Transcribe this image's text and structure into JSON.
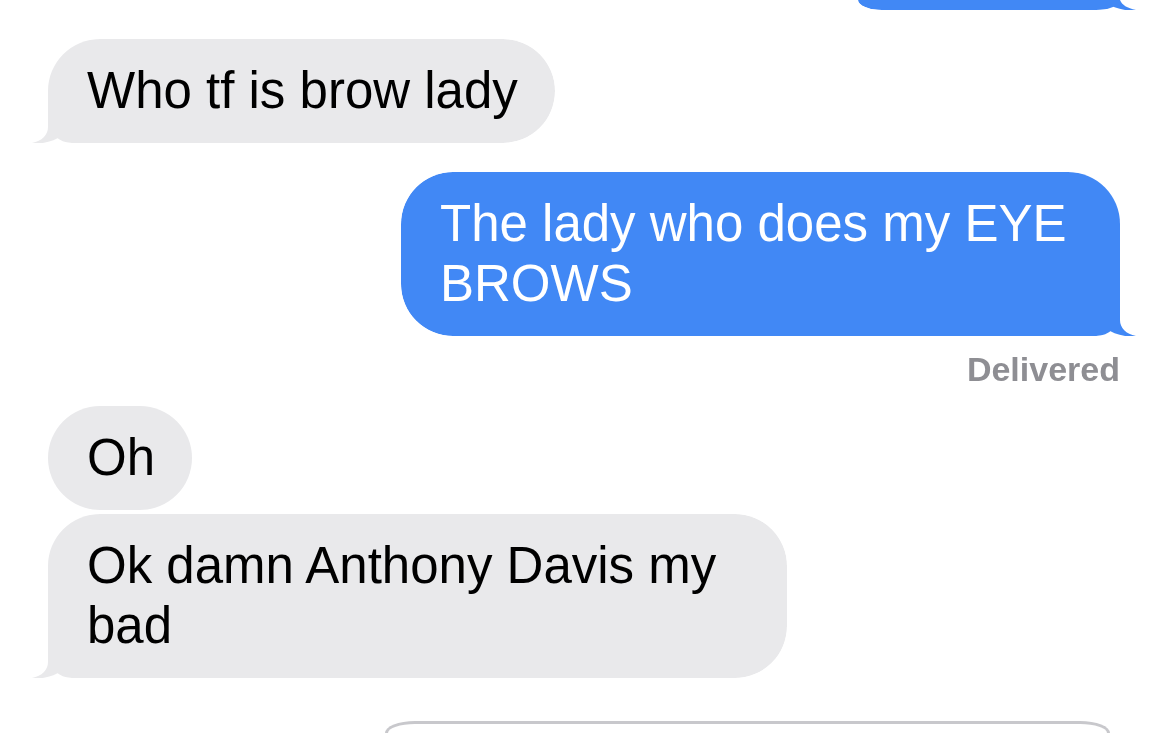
{
  "messages": [
    {
      "kind": "outgoing",
      "tail": true
    },
    {
      "kind": "incoming",
      "text": "Who tf is brow lady",
      "tail": true
    },
    {
      "kind": "outgoing",
      "text": "The lady who does my EYE BROWS",
      "tail": true,
      "status": "Delivered"
    },
    {
      "kind": "incoming",
      "text": "Oh",
      "tail": false
    },
    {
      "kind": "incoming",
      "text": "Ok damn Anthony Davis my bad",
      "tail": true
    }
  ]
}
